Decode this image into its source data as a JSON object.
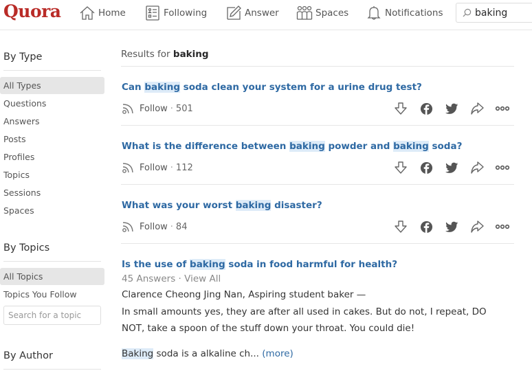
{
  "header": {
    "logo": "Quora",
    "nav": [
      {
        "label": "Home",
        "icon": "home-icon"
      },
      {
        "label": "Following",
        "icon": "following-icon"
      },
      {
        "label": "Answer",
        "icon": "answer-icon"
      },
      {
        "label": "Spaces",
        "icon": "spaces-icon"
      },
      {
        "label": "Notifications",
        "icon": "bell-icon"
      }
    ],
    "search_value": "baking"
  },
  "sidebar": {
    "by_type": {
      "heading": "By Type",
      "items": [
        "All Types",
        "Questions",
        "Answers",
        "Posts",
        "Profiles",
        "Topics",
        "Sessions",
        "Spaces"
      ],
      "active": "All Types"
    },
    "by_topics": {
      "heading": "By Topics",
      "items": [
        "All Topics",
        "Topics You Follow"
      ],
      "active": "All Topics",
      "search_placeholder": "Search for a topic"
    },
    "by_author": {
      "heading": "By Author"
    }
  },
  "main": {
    "results_prefix": "Results for",
    "query": "baking",
    "questions": [
      {
        "title_parts": [
          "Can ",
          "baking",
          " soda clean your system for a urine drug test?"
        ],
        "follow_label": "Follow",
        "follow_count": "501"
      },
      {
        "title_parts": [
          "What is the difference between ",
          "baking",
          " powder and ",
          "baking",
          " soda?"
        ],
        "follow_label": "Follow",
        "follow_count": "112"
      },
      {
        "title_parts": [
          "What was your worst ",
          "baking",
          " disaster?"
        ],
        "follow_label": "Follow",
        "follow_count": "84"
      }
    ],
    "answer_result": {
      "title_parts": [
        "Is the use of ",
        "baking",
        " soda in food harmful for health?"
      ],
      "answers_count": "45 Answers",
      "view_all": "View All",
      "author": "Clarence Cheong Jing Nan, Aspiring student baker —",
      "text": "In small amounts yes, they are after all used in cakes. But do not, I repeat, DO NOT, take a spoon of the stuff down your throat. You could die!",
      "snippet_highlight": "Baking",
      "snippet_rest": " soda is a alkaline ch... ",
      "more_label": "(more)"
    },
    "action_icons": [
      "downvote-icon",
      "facebook-icon",
      "twitter-icon",
      "share-icon",
      "more-icon"
    ]
  }
}
